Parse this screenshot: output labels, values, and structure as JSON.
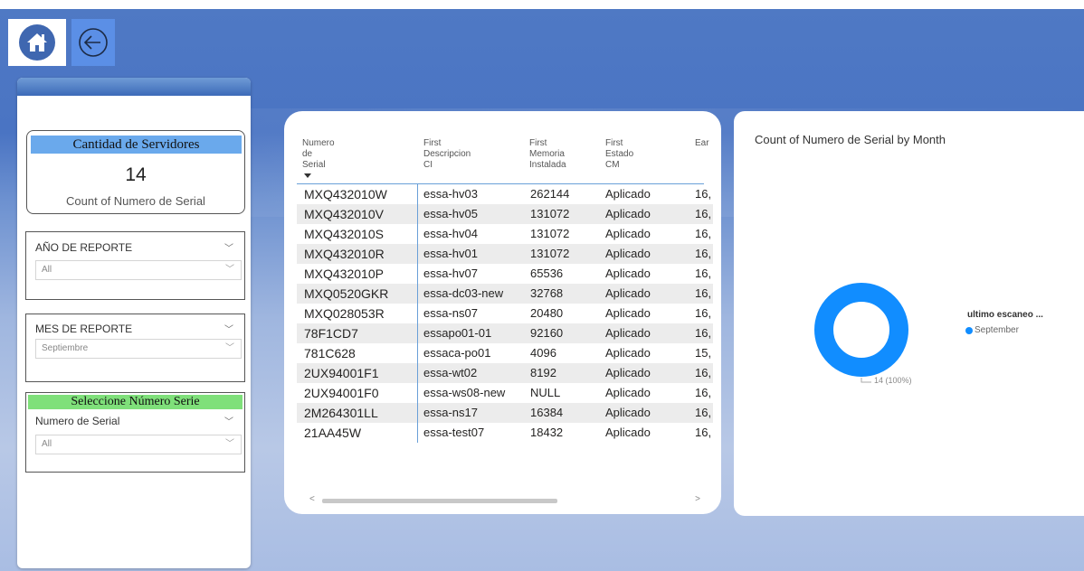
{
  "nav": {
    "home_icon": "home-icon",
    "back_icon": "back-arrow-icon"
  },
  "card": {
    "title": "Cantidad de Servidores",
    "value": "14",
    "label": "Count of Numero de Serial"
  },
  "slicers": [
    {
      "title": "AÑO DE REPORTE",
      "value": "All"
    },
    {
      "title": "MES DE REPORTE",
      "value": "Septiembre"
    },
    {
      "heading": "Seleccione Número Serie",
      "title": "Numero de Serial",
      "value": "All"
    }
  ],
  "table": {
    "headers": [
      "Numero de Serial",
      "First Descripcion CI",
      "First Memoria Instalada",
      "First Estado CM",
      "Ear"
    ],
    "rows": [
      [
        "MXQ432010W",
        "essa-hv03",
        "262144",
        "Aplicado",
        "16,"
      ],
      [
        "MXQ432010V",
        "essa-hv05",
        "131072",
        "Aplicado",
        "16,"
      ],
      [
        "MXQ432010S",
        "essa-hv04",
        "131072",
        "Aplicado",
        "16,"
      ],
      [
        "MXQ432010R",
        "essa-hv01",
        "131072",
        "Aplicado",
        "16,"
      ],
      [
        "MXQ432010P",
        "essa-hv07",
        "65536",
        "Aplicado",
        "16,"
      ],
      [
        "MXQ0520GKR",
        "essa-dc03-new",
        "32768",
        "Aplicado",
        "16,"
      ],
      [
        "MXQ028053R",
        "essa-ns07",
        "20480",
        "Aplicado",
        "16,"
      ],
      [
        "78F1CD7",
        "essapo01-01",
        "92160",
        "Aplicado",
        "16,"
      ],
      [
        "781C628",
        "essaca-po01",
        "4096",
        "Aplicado",
        "15,"
      ],
      [
        "2UX94001F1",
        "essa-wt02",
        "8192",
        "Aplicado",
        "16,"
      ],
      [
        "2UX94001F0",
        "essa-ws08-new",
        "NULL",
        "Aplicado",
        "16,"
      ],
      [
        "2M264301LL",
        "essa-ns17",
        "16384",
        "Aplicado",
        "16,"
      ],
      [
        "21AA45W",
        "essa-test07",
        "18432",
        "Aplicado",
        "16,"
      ]
    ]
  },
  "chart_data": {
    "type": "pie",
    "title": "Count of Numero de Serial by Month",
    "legend_title": "ultimo escaneo ...",
    "categories": [
      "September"
    ],
    "values": [
      14
    ],
    "data_label": "14 (100%)",
    "colors": [
      "#118dff"
    ]
  }
}
